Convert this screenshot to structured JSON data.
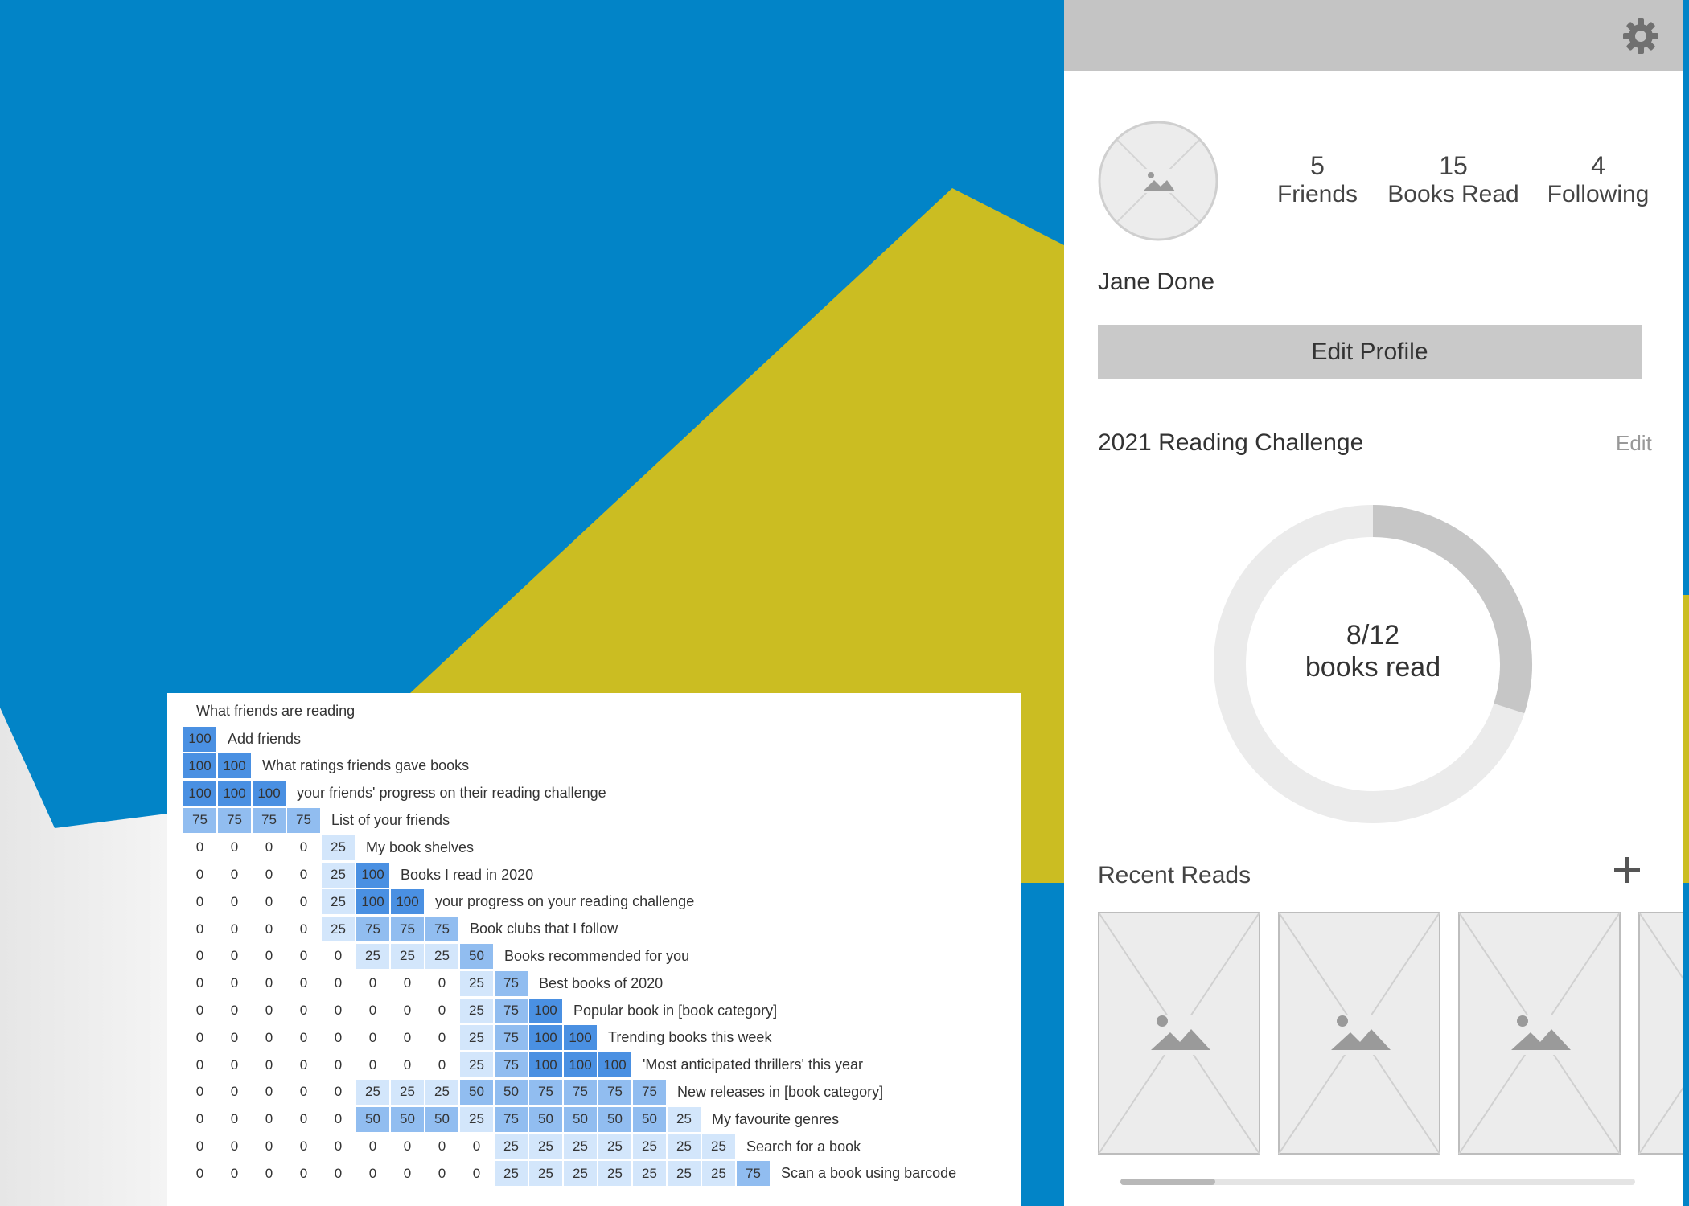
{
  "colors": {
    "blue": "#0284c7",
    "yellow": "#cbbd22",
    "cell_dark": "#4a90e2",
    "cell_mid": "#91bdf0",
    "cell_light": "#d3e6fb"
  },
  "profile": {
    "settings_icon": "gear-icon",
    "avatar_icon": "image-placeholder-icon",
    "stats": [
      {
        "value": "5",
        "label": "Friends"
      },
      {
        "value": "15",
        "label": "Books Read"
      },
      {
        "value": "4",
        "label": "Following"
      }
    ],
    "name": "Jane Done",
    "edit_profile_label": "Edit Profile",
    "challenge_title": "2021 Reading Challenge",
    "challenge_edit": "Edit",
    "progress_text": "8/12",
    "progress_sub": "books read",
    "progress_fraction": 0.3,
    "recent_reads_title": "Recent Reads",
    "add_icon": "plus-icon",
    "book_icon": "image-placeholder-icon"
  },
  "matrix": {
    "title": "What friends are reading",
    "rows": [
      {
        "label": "Add friends",
        "values": [
          100
        ]
      },
      {
        "label": "What ratings friends gave books",
        "values": [
          100,
          100
        ]
      },
      {
        "label": "your friends' progress on their reading challenge",
        "values": [
          100,
          100,
          100
        ]
      },
      {
        "label": "List of your friends",
        "values": [
          75,
          75,
          75,
          75
        ]
      },
      {
        "label": "My book shelves",
        "values": [
          0,
          0,
          0,
          0,
          25
        ]
      },
      {
        "label": "Books I read in 2020",
        "values": [
          0,
          0,
          0,
          0,
          25,
          100
        ]
      },
      {
        "label": "your progress on your reading challenge",
        "values": [
          0,
          0,
          0,
          0,
          25,
          100,
          100
        ]
      },
      {
        "label": "Book clubs that I follow",
        "values": [
          0,
          0,
          0,
          0,
          25,
          75,
          75,
          75
        ]
      },
      {
        "label": "Books recommended for you",
        "values": [
          0,
          0,
          0,
          0,
          0,
          25,
          25,
          25,
          50
        ]
      },
      {
        "label": "Best books of 2020",
        "values": [
          0,
          0,
          0,
          0,
          0,
          0,
          0,
          0,
          25,
          75
        ]
      },
      {
        "label": "Popular book in [book category]",
        "values": [
          0,
          0,
          0,
          0,
          0,
          0,
          0,
          0,
          25,
          75,
          100
        ]
      },
      {
        "label": "Trending books this week",
        "values": [
          0,
          0,
          0,
          0,
          0,
          0,
          0,
          0,
          25,
          75,
          100,
          100
        ]
      },
      {
        "label": "'Most anticipated thrillers' this year",
        "values": [
          0,
          0,
          0,
          0,
          0,
          0,
          0,
          0,
          25,
          75,
          100,
          100,
          100
        ]
      },
      {
        "label": "New releases in [book category]",
        "values": [
          0,
          0,
          0,
          0,
          0,
          25,
          25,
          25,
          50,
          50,
          75,
          75,
          75,
          75
        ]
      },
      {
        "label": "My favourite genres",
        "values": [
          0,
          0,
          0,
          0,
          0,
          50,
          50,
          50,
          25,
          75,
          50,
          50,
          50,
          50,
          25
        ]
      },
      {
        "label": "Search for a book",
        "values": [
          0,
          0,
          0,
          0,
          0,
          0,
          0,
          0,
          0,
          25,
          25,
          25,
          25,
          25,
          25,
          25
        ]
      },
      {
        "label": "Scan a book using barcode",
        "values": [
          0,
          0,
          0,
          0,
          0,
          0,
          0,
          0,
          0,
          25,
          25,
          25,
          25,
          25,
          25,
          25,
          75
        ]
      }
    ]
  }
}
